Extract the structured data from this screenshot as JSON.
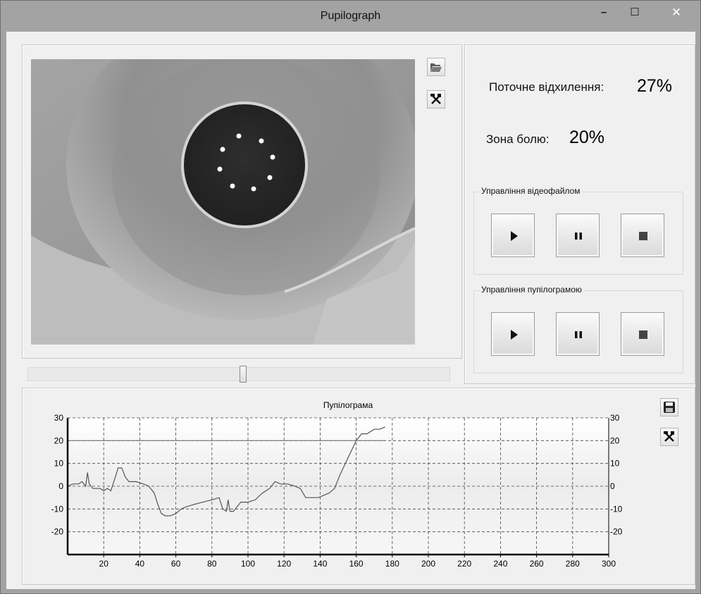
{
  "window": {
    "title": "Pupilograph",
    "minimize": "–",
    "maximize": "☐",
    "close": "✕"
  },
  "info": {
    "deviation_label": "Поточне відхилення:",
    "deviation_value": "27%",
    "pain_zone_label": "Зона болю:",
    "pain_zone_value": "20%"
  },
  "video_controls": {
    "title": "Управління відеофайлом"
  },
  "pupilogram_controls": {
    "title": "Управління пупілограмою"
  },
  "video": {
    "open_icon": "folder-open-icon",
    "settings_icon": "tools-icon"
  },
  "slider": {
    "position_fraction": 0.51
  },
  "chart_icons": {
    "save_icon": "floppy-disk-icon",
    "settings_icon": "tools-icon"
  },
  "chart_data": {
    "type": "line",
    "title": "Пупілограма",
    "xlabel": "",
    "ylabel": "",
    "xlim": [
      0,
      300
    ],
    "ylim": [
      -30,
      30
    ],
    "x_ticks": [
      20,
      40,
      60,
      80,
      100,
      120,
      140,
      160,
      180,
      200,
      220,
      240,
      260,
      280,
      300
    ],
    "y_ticks": [
      30,
      20,
      10,
      0,
      -10,
      -20
    ],
    "grid": true,
    "series": [
      {
        "values": [
          [
            0,
            0
          ],
          [
            3,
            1
          ],
          [
            6,
            1
          ],
          [
            8,
            2
          ],
          [
            10,
            0
          ],
          [
            11,
            6
          ],
          [
            12,
            1
          ],
          [
            14,
            -1
          ],
          [
            18,
            -1
          ],
          [
            20,
            -2
          ],
          [
            22,
            -1
          ],
          [
            24,
            -2
          ],
          [
            26,
            3
          ],
          [
            28,
            8
          ],
          [
            30,
            8
          ],
          [
            32,
            4
          ],
          [
            34,
            2
          ],
          [
            38,
            2
          ],
          [
            42,
            1
          ],
          [
            45,
            0
          ],
          [
            48,
            -3
          ],
          [
            50,
            -8
          ],
          [
            52,
            -12
          ],
          [
            54,
            -13
          ],
          [
            57,
            -13
          ],
          [
            60,
            -12
          ],
          [
            63,
            -10
          ],
          [
            66,
            -9
          ],
          [
            70,
            -8
          ],
          [
            75,
            -7
          ],
          [
            80,
            -6
          ],
          [
            84,
            -5
          ],
          [
            86,
            -10
          ],
          [
            88,
            -11
          ],
          [
            89,
            -6
          ],
          [
            90,
            -11
          ],
          [
            92,
            -11
          ],
          [
            94,
            -9
          ],
          [
            96,
            -7
          ],
          [
            100,
            -7
          ],
          [
            104,
            -6
          ],
          [
            108,
            -3
          ],
          [
            112,
            -1
          ],
          [
            115,
            2
          ],
          [
            118,
            1
          ],
          [
            122,
            1
          ],
          [
            126,
            0
          ],
          [
            129,
            -1
          ],
          [
            132,
            -5
          ],
          [
            135,
            -5
          ],
          [
            139,
            -5
          ],
          [
            142,
            -4
          ],
          [
            145,
            -3
          ],
          [
            148,
            -1
          ],
          [
            151,
            5
          ],
          [
            154,
            10
          ],
          [
            157,
            15
          ],
          [
            160,
            20
          ],
          [
            163,
            23
          ],
          [
            166,
            23
          ],
          [
            170,
            25
          ],
          [
            173,
            25
          ],
          [
            176,
            26
          ]
        ]
      },
      {
        "values": [
          [
            0,
            20
          ],
          [
            176,
            20
          ]
        ]
      }
    ]
  }
}
